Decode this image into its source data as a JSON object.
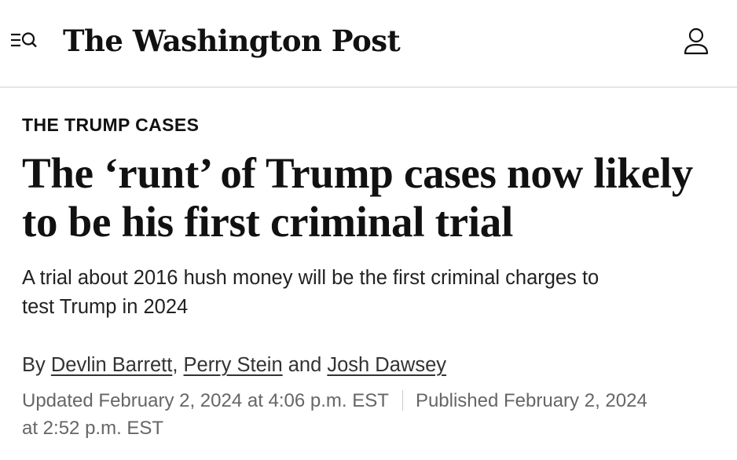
{
  "header": {
    "menu_icon": "menu-search-icon",
    "masthead": "The Washington Post",
    "account_icon": "user-account-icon"
  },
  "article": {
    "kicker": "THE TRUMP CASES",
    "headline_line1": "The ‘runt’ of Trump cases now likely",
    "headline_line2": "to be his first criminal trial",
    "dek_line1": "A trial about 2016 hush money will be the first criminal charges to",
    "dek_line2": "test Trump in 2024",
    "byline": {
      "prefix": "By ",
      "authors": [
        "Devlin Barrett",
        "Perry Stein",
        "Josh Dawsey"
      ],
      "comma": ", ",
      "and": " and "
    },
    "updated": "Updated February 2, 2024 at 4:06 p.m. EST",
    "published_part1": "Published February 2, 2024",
    "published_part2": "at 2:52 p.m. EST"
  },
  "colors": {
    "text": "#111111",
    "meta": "#666666",
    "divider": "#e6e6e6"
  }
}
